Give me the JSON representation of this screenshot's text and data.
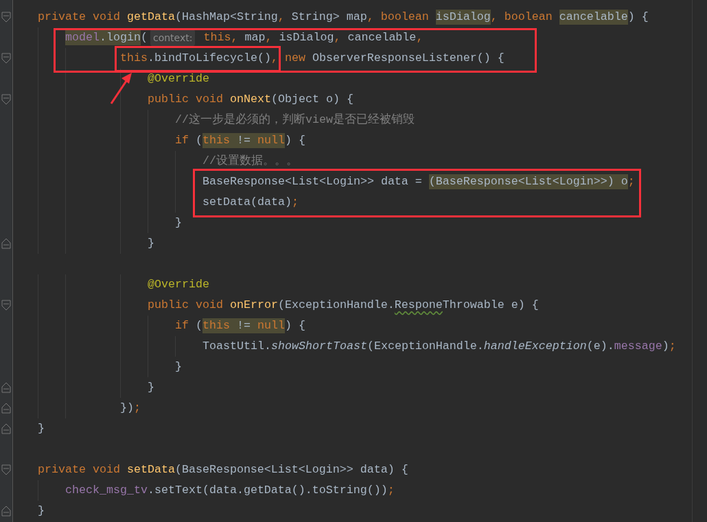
{
  "editor": {
    "lines": [
      {
        "kind": "code",
        "fold_start": true,
        "tokens": [
          {
            "text": "private void ",
            "kind": "kw"
          },
          {
            "text": "getData",
            "kind": "decl"
          },
          {
            "text": "(HashMap<String",
            "kind": "plain"
          },
          {
            "text": ", ",
            "kind": "punct"
          },
          {
            "text": "String> map",
            "kind": "plain"
          },
          {
            "text": ", ",
            "kind": "punct"
          },
          {
            "text": "boolean ",
            "kind": "kw"
          },
          {
            "text": "isDialog",
            "kind": "plain",
            "highlighted": true
          },
          {
            "text": ", ",
            "kind": "punct"
          },
          {
            "text": "boolean ",
            "kind": "kw"
          },
          {
            "text": "cancelable",
            "kind": "plain",
            "highlighted": true
          },
          {
            "text": ") {",
            "kind": "plain"
          }
        ],
        "children": [
          {
            "kind": "code",
            "tokens": [
              {
                "text": "model",
                "kind": "field",
                "highlighted": true
              },
              {
                "text": ".login",
                "kind": "plain",
                "highlighted": true
              },
              {
                "text": "(",
                "kind": "plain"
              },
              {
                "text": "context:",
                "kind": "hint"
              },
              {
                "text": " this",
                "kind": "kw"
              },
              {
                "text": ", ",
                "kind": "punct"
              },
              {
                "text": "map",
                "kind": "plain"
              },
              {
                "text": ", ",
                "kind": "punct"
              },
              {
                "text": "isDialog",
                "kind": "plain"
              },
              {
                "text": ", ",
                "kind": "punct"
              },
              {
                "text": "cancelable",
                "kind": "plain"
              },
              {
                "text": ",",
                "kind": "punct"
              }
            ],
            "children": [
              {
                "kind": "continuation",
                "fold_start": true,
                "tokens": [
                  {
                    "text": "this",
                    "kind": "kw"
                  },
                  {
                    "text": ".bindToLifecycle()",
                    "kind": "plain"
                  },
                  {
                    "text": ", ",
                    "kind": "punct"
                  },
                  {
                    "text": "new ",
                    "kind": "kw"
                  },
                  {
                    "text": "ObserverResponseListener() {",
                    "kind": "plain"
                  }
                ],
                "children": [
                  {
                    "kind": "code",
                    "tokens": [
                      {
                        "text": "@Override",
                        "kind": "ann"
                      }
                    ]
                  },
                  {
                    "kind": "code",
                    "fold_start": true,
                    "tokens": [
                      {
                        "text": "public void ",
                        "kind": "kw"
                      },
                      {
                        "text": "onNext",
                        "kind": "decl"
                      },
                      {
                        "text": "(Object o) {",
                        "kind": "plain"
                      }
                    ],
                    "children": [
                      {
                        "kind": "code",
                        "tokens": [
                          {
                            "text": "//这一步是必须的，判断view是否已经被销毁",
                            "kind": "comment"
                          }
                        ]
                      },
                      {
                        "kind": "code",
                        "tokens": [
                          {
                            "text": "if ",
                            "kind": "kw"
                          },
                          {
                            "text": "(",
                            "kind": "plain"
                          },
                          {
                            "text": "this",
                            "kind": "kw",
                            "highlighted": true
                          },
                          {
                            "text": " != ",
                            "kind": "plain",
                            "highlighted": true
                          },
                          {
                            "text": "null",
                            "kind": "kw",
                            "highlighted": true
                          },
                          {
                            "text": ") {",
                            "kind": "plain"
                          }
                        ],
                        "children": [
                          {
                            "kind": "code",
                            "tokens": [
                              {
                                "text": "//设置数据。。。",
                                "kind": "comment"
                              }
                            ]
                          },
                          {
                            "kind": "code",
                            "tokens": [
                              {
                                "text": "BaseResponse<List<Login>> data = ",
                                "kind": "plain"
                              },
                              {
                                "text": "(BaseResponse<List<Login>>) o",
                                "kind": "plain",
                                "highlighted": true
                              },
                              {
                                "text": ";",
                                "kind": "punct"
                              }
                            ]
                          },
                          {
                            "kind": "code",
                            "tokens": [
                              {
                                "text": "setData(data)",
                                "kind": "plain"
                              },
                              {
                                "text": ";",
                                "kind": "punct"
                              }
                            ]
                          }
                        ]
                      },
                      {
                        "kind": "code",
                        "tokens": [
                          {
                            "text": "}",
                            "kind": "plain"
                          }
                        ]
                      }
                    ]
                  },
                  {
                    "kind": "code",
                    "fold_end": true,
                    "tokens": [
                      {
                        "text": "}",
                        "kind": "plain"
                      }
                    ]
                  },
                  {
                    "kind": "blank"
                  },
                  {
                    "kind": "code",
                    "tokens": [
                      {
                        "text": "@Override",
                        "kind": "ann"
                      }
                    ]
                  },
                  {
                    "kind": "code",
                    "fold_start": true,
                    "tokens": [
                      {
                        "text": "public void ",
                        "kind": "kw"
                      },
                      {
                        "text": "onError",
                        "kind": "decl"
                      },
                      {
                        "text": "(ExceptionHandle.",
                        "kind": "plain"
                      },
                      {
                        "text": "Respone",
                        "kind": "plain",
                        "typo": true
                      },
                      {
                        "text": "Throwable e) {",
                        "kind": "plain"
                      }
                    ],
                    "children": [
                      {
                        "kind": "code",
                        "tokens": [
                          {
                            "text": "if ",
                            "kind": "kw"
                          },
                          {
                            "text": "(",
                            "kind": "plain"
                          },
                          {
                            "text": "this",
                            "kind": "kw",
                            "highlighted": true
                          },
                          {
                            "text": " != ",
                            "kind": "plain",
                            "highlighted": true
                          },
                          {
                            "text": "null",
                            "kind": "kw",
                            "highlighted": true
                          },
                          {
                            "text": ") {",
                            "kind": "plain"
                          }
                        ],
                        "children": [
                          {
                            "kind": "code",
                            "tokens": [
                              {
                                "text": "ToastUtil.",
                                "kind": "plain"
                              },
                              {
                                "text": "showShortToast",
                                "kind": "static"
                              },
                              {
                                "text": "(ExceptionHandle.",
                                "kind": "plain"
                              },
                              {
                                "text": "handleException",
                                "kind": "static"
                              },
                              {
                                "text": "(e).",
                                "kind": "plain"
                              },
                              {
                                "text": "message",
                                "kind": "field"
                              },
                              {
                                "text": ")",
                                "kind": "plain"
                              },
                              {
                                "text": ";",
                                "kind": "punct"
                              }
                            ]
                          }
                        ]
                      },
                      {
                        "kind": "code",
                        "tokens": [
                          {
                            "text": "}",
                            "kind": "plain"
                          }
                        ]
                      }
                    ]
                  },
                  {
                    "kind": "code",
                    "fold_end": true,
                    "tokens": [
                      {
                        "text": "}",
                        "kind": "plain"
                      }
                    ]
                  }
                ]
              },
              {
                "kind": "continuation",
                "fold_end": true,
                "tokens": [
                  {
                    "text": "})",
                    "kind": "plain"
                  },
                  {
                    "text": ";",
                    "kind": "punct"
                  }
                ]
              }
            ]
          }
        ]
      },
      {
        "kind": "code",
        "fold_end": true,
        "tokens": [
          {
            "text": "}",
            "kind": "plain"
          }
        ]
      },
      {
        "kind": "blank"
      },
      {
        "kind": "code",
        "fold_start": true,
        "tokens": [
          {
            "text": "private void ",
            "kind": "kw"
          },
          {
            "text": "setData",
            "kind": "decl"
          },
          {
            "text": "(BaseResponse<List<Login>> data) {",
            "kind": "plain"
          }
        ],
        "children": [
          {
            "kind": "code",
            "tokens": [
              {
                "text": "check_msg_tv",
                "kind": "field"
              },
              {
                "text": ".setText(data.getData().toString())",
                "kind": "plain"
              },
              {
                "text": ";",
                "kind": "punct"
              }
            ]
          }
        ]
      },
      {
        "kind": "code",
        "fold_end": true,
        "tokens": [
          {
            "text": "}",
            "kind": "plain"
          }
        ]
      }
    ]
  }
}
